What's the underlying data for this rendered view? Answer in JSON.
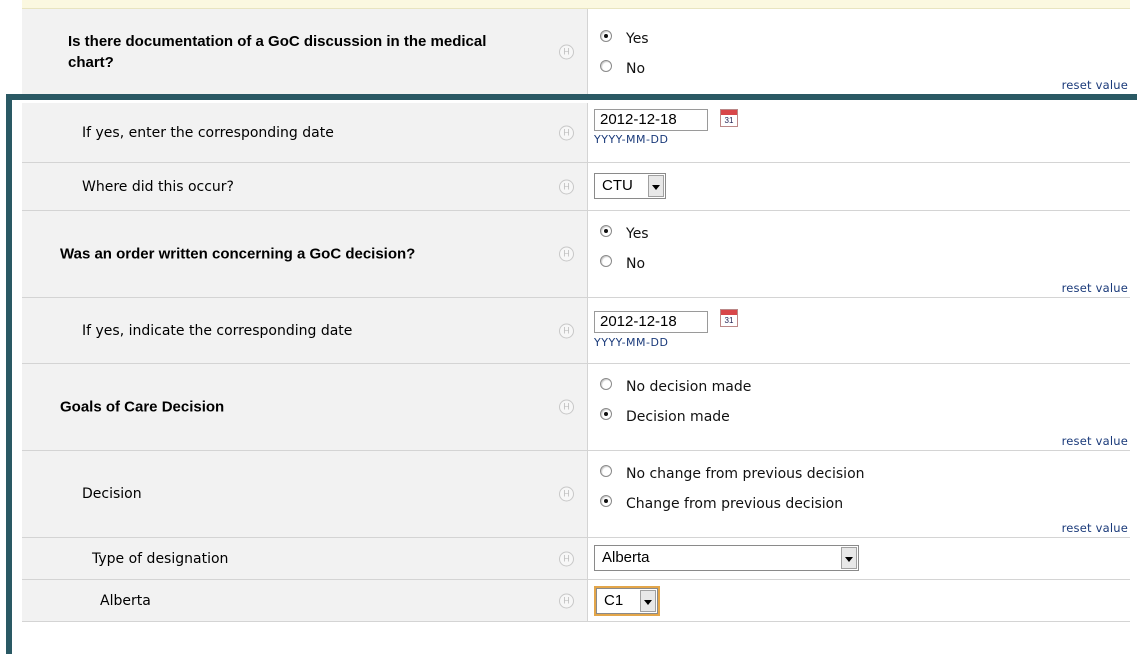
{
  "form": {
    "help_glyph": "H",
    "reset_label": "reset value",
    "date_format": "YYYY-MM-DD",
    "calendar_day": "31",
    "q1": {
      "label": "Is there documentation of a GoC discussion in the medical chart?",
      "options": [
        "Yes",
        "No"
      ],
      "selected": "Yes"
    },
    "q2": {
      "label": "If yes, enter the corresponding date",
      "value": "2012-12-18"
    },
    "q3": {
      "label": "Where did this occur?",
      "value": "CTU"
    },
    "q4": {
      "label": "Was an order written concerning a GoC decision?",
      "options": [
        "Yes",
        "No"
      ],
      "selected": "Yes"
    },
    "q5": {
      "label": "If yes, indicate the corresponding date",
      "value": "2012-12-18"
    },
    "q6": {
      "label": "Goals of Care Decision",
      "options": [
        "No decision made",
        "Decision made"
      ],
      "selected": "Decision made"
    },
    "q7": {
      "label": "Decision",
      "options": [
        "No change from previous decision",
        "Change from previous decision"
      ],
      "selected": "Change from previous decision"
    },
    "q8": {
      "label": "Type of designation",
      "value": "Alberta"
    },
    "q9": {
      "label": "Alberta",
      "value": "C1"
    }
  },
  "colors": {
    "frame": "#2a5964",
    "link": "#1a3a7a",
    "focus": "#e3a64a",
    "label_bg": "#f2f2f2"
  }
}
